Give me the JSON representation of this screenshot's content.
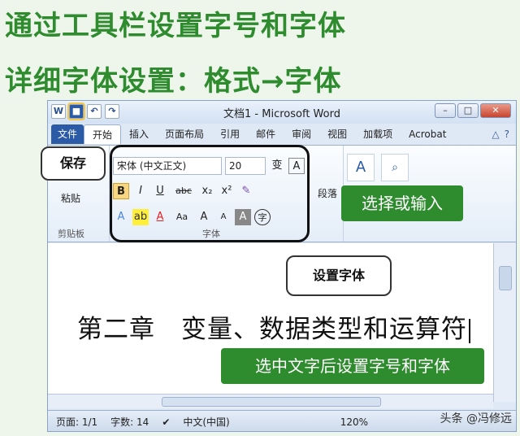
{
  "slide": {
    "title1": "通过工具栏设置字号和字体",
    "title2": "详细字体设置：格式→字体"
  },
  "word": {
    "window_title": "文档1 - Microsoft Word",
    "qat": {
      "app_icon": "W",
      "undo": "↶",
      "redo": "↷"
    },
    "tabs": [
      "文件",
      "开始",
      "插入",
      "页面布局",
      "引用",
      "邮件",
      "审阅",
      "视图",
      "加载项",
      "Acrobat"
    ],
    "clipboard": {
      "paste": "粘贴",
      "label": "剪贴板"
    },
    "font": {
      "name_value": "宋体 (中文正文)",
      "size_value": "20",
      "group_label": "字体",
      "buttons": {
        "bold": "B",
        "italic": "I",
        "underline": "U",
        "strike": "abc",
        "sub": "x₂",
        "sup": "x²",
        "grow": "A",
        "shrink": "A",
        "case": "Aa"
      }
    },
    "paragraph": {
      "label": "段落"
    },
    "document_text": "第二章　变量、数据类型和运算符",
    "status": {
      "page": "页面: 1/1",
      "words": "字数: 14",
      "language": "中文(中国)",
      "zoom": "120%"
    }
  },
  "callouts": {
    "save": "保存",
    "select_or_input": "选择或输入",
    "set_font": "设置字体",
    "hint": "选中文字后设置字号和字体"
  },
  "watermark": "头条 @冯修远"
}
